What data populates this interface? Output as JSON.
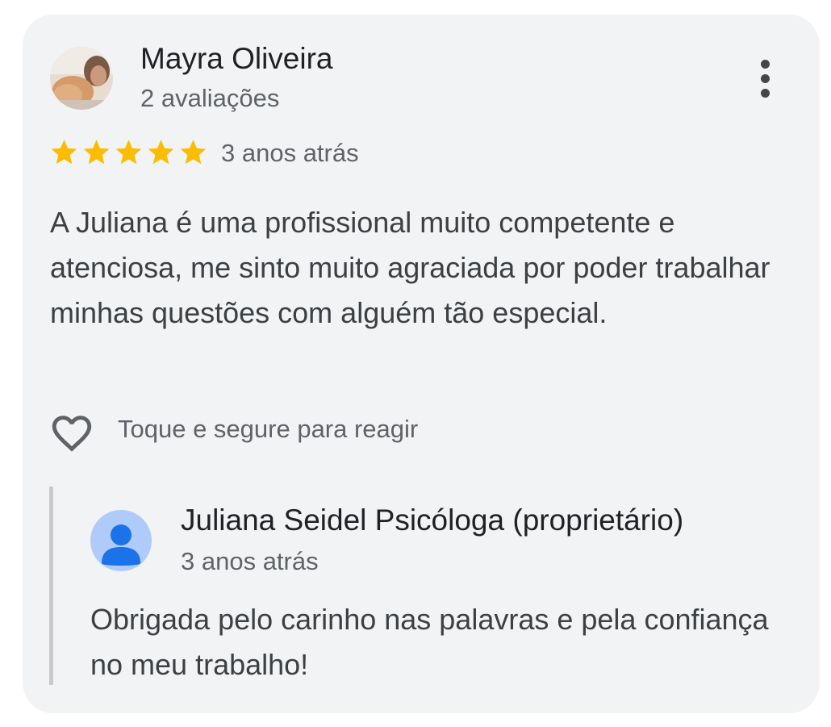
{
  "review": {
    "reviewer_name": "Mayra Oliveira",
    "reviewer_meta": "2 avaliações",
    "rating": 5,
    "rating_max": 5,
    "date": "3 anos atrás",
    "text": "A Juliana é uma profissional muito competente e atenciosa, me sinto muito agraciada por poder trabalhar minhas questões com alguém tão especial.",
    "menu_icon": "more-vert-icon",
    "reaction_icon": "heart-outline-icon",
    "reaction_hint": "Toque e segure para reagir"
  },
  "reply": {
    "owner_name": "Juliana Seidel Psicóloga (proprietário)",
    "date": "3 anos atrás",
    "text": "Obrigada pelo carinho nas palavras e pela confiança no meu trabalho!",
    "avatar_icon": "person-icon"
  },
  "colors": {
    "card_background": "#f2f3f5",
    "star": "#fbbc04",
    "owner_avatar": "#aecbfa",
    "owner_avatar_glyph": "#1a73e8",
    "reply_bar": "#c7c9cc"
  }
}
